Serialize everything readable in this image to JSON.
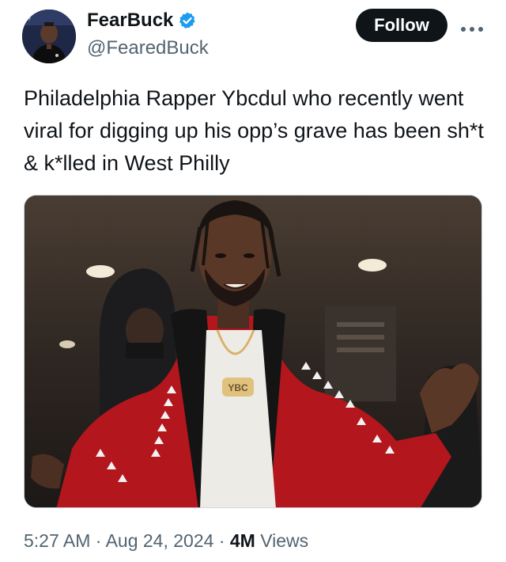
{
  "author": {
    "display_name": "FearBuck",
    "handle": "@FearedBuck",
    "avatar_icon": "profile-avatar",
    "verified_icon": "verified-badge-icon",
    "verified_color": "#1d9bf0"
  },
  "actions": {
    "follow_label": "Follow",
    "more_icon": "more-options-icon"
  },
  "tweet": {
    "text": "Philadelphia Rapper Ybcdul who recently went viral for digging up his opp’s grave has been sh*t & k*lled in West Philly"
  },
  "media": {
    "description_icon": "photo",
    "chain_pendant_text": "YBC"
  },
  "meta": {
    "time": "5:27 AM",
    "separator": "·",
    "date": "Aug 24, 2024",
    "views_count": "4M",
    "views_label": "Views"
  },
  "colors": {
    "text_primary": "#0f1419",
    "text_secondary": "#536471",
    "follow_bg": "#0f1419",
    "jacket_red": "#b3161c"
  }
}
